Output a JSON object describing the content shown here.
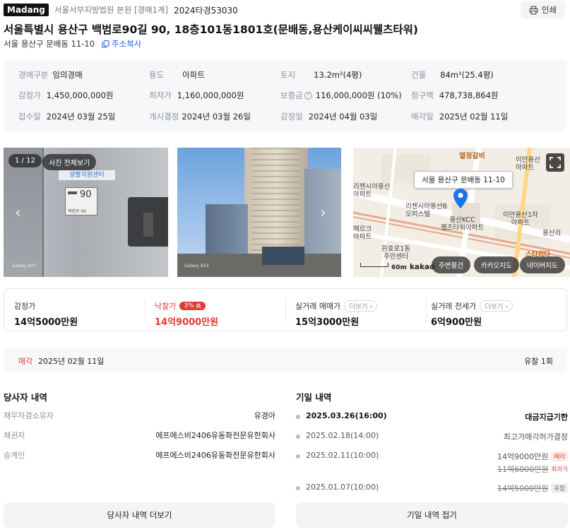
{
  "header": {
    "brand": "Madang",
    "court": "서울서부지방법원 본원 [경매1계]",
    "case_no": "2024타경53030",
    "print_label": "인쇄"
  },
  "property": {
    "title": "서울특별시 용산구 백범로90길 90, 18층101동1801호(문배동,용산케이씨씨웰츠타워)",
    "short_address": "서울 용산구 문배동 11-10",
    "copy_label": "주소복사"
  },
  "info": {
    "auction_type": {
      "label": "경매구분",
      "value": "임의경매"
    },
    "usage": {
      "label": "용도",
      "value": "아파트"
    },
    "land": {
      "label": "토지",
      "value": "13.2m²(4평)"
    },
    "building": {
      "label": "건물",
      "value": "84m²(25.4평)"
    },
    "appraisal": {
      "label": "감정가",
      "value": "1,450,000,000원"
    },
    "minimum": {
      "label": "최저가",
      "value": "1,160,000,000원"
    },
    "deposit": {
      "label": "보증금",
      "value": "116,000,000원 (10%)"
    },
    "claim": {
      "label": "청구액",
      "value": "478,738,864원"
    },
    "received": {
      "label": "접수일",
      "value": "2024년 03월 25일"
    },
    "start_decision": {
      "label": "개시결정",
      "value": "2024년 03월 26일"
    },
    "appraisal_date": {
      "label": "감정일",
      "value": "2024년 04월 03일"
    },
    "sale_date": {
      "label": "매각일",
      "value": "2025년 02월 11일"
    }
  },
  "gallery": {
    "counter": "1 / 12",
    "view_all": "사진 전체보기",
    "photo1_sign": "생활지원센터",
    "photo1_plate_no": "90",
    "photo1_plate_text": "백범로 90",
    "photo1_watermark": "Galaxy A23",
    "photo2_watermark": "Galaxy A23"
  },
  "map": {
    "label_top": "열정갈비",
    "pin_address": "서울 용산구 문배동 11-10",
    "labels": {
      "richensia": "리첸시아용산\n아파트",
      "richensia_b": "리첸시아용산B\n오피스텔",
      "kcc": "용산KCC\n웰츠타워아파트",
      "ian": "이안용산\n아파트",
      "ian1": "이안용산1차\n아파트",
      "yongsan": "용산리",
      "center": "원효로1동\n주민센터",
      "star": "스타리다",
      "herc": "헤르크\n아파트"
    },
    "scale": "60m",
    "logo": "kakao",
    "btn_nearby": "주변물건",
    "btn_kakao": "카카오지도",
    "btn_naver": "네이버지도"
  },
  "prices": {
    "appraisal": {
      "label": "감정가",
      "value": "14억5000만원"
    },
    "winning": {
      "label": "낙찰가",
      "badge": "3%",
      "value": "14억9000만원"
    },
    "trade": {
      "label": "실거래 매매가",
      "more": "더보기",
      "value": "15억3000만원"
    },
    "lease": {
      "label": "실거래 전세가",
      "more": "더보기",
      "value": "6억900만원"
    }
  },
  "sale_bar": {
    "label": "매각",
    "date": "2025년 02월 11일",
    "fail_count": "유찰 1회"
  },
  "parties": {
    "title": "당사자 내역",
    "rows": [
      {
        "label": "채무자겸소유자",
        "value": "유경아"
      },
      {
        "label": "채권자",
        "value": "에프에스비2406유동화전문유한회사"
      },
      {
        "label": "승계인",
        "value": "에프에스비2406유동화전문유한회사"
      }
    ],
    "more_button": "당사자 내역 더보기"
  },
  "history": {
    "title": "기일 내역",
    "rows": [
      {
        "date": "2025.03.26(16:00)",
        "status": "대금지급기한"
      },
      {
        "date": "2025.02.18(14:00)",
        "status": "최고가매각허가결정"
      },
      {
        "date": "2025.02.11(10:00)",
        "status": "14억9000만원",
        "tag": "매각",
        "sub_value": "11억6000만원",
        "sub_tag": "최저가"
      },
      {
        "date": "2025.01.07(10:00)",
        "status": "14억5000만원",
        "tag": "유찰"
      }
    ],
    "fold_button": "기일 내역 접기"
  },
  "colors": {
    "accent_red": "#e53935",
    "link_blue": "#2563eb",
    "map_pin": "#1a73e8"
  }
}
